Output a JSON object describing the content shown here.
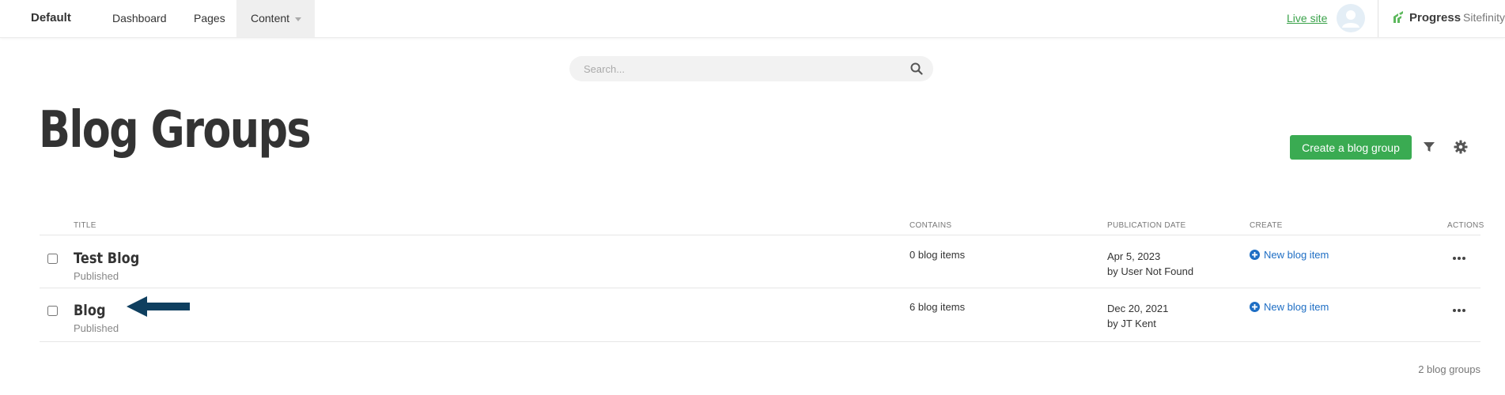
{
  "topbar": {
    "site_name": "Default",
    "nav": {
      "dashboard": "Dashboard",
      "pages": "Pages",
      "content": "Content"
    },
    "live_site": "Live site",
    "brand_progress": "Progress",
    "brand_sitefinity": "Sitefinity"
  },
  "search": {
    "placeholder": "Search..."
  },
  "page": {
    "title": "Blog Groups",
    "create_button": "Create a blog group"
  },
  "table": {
    "headers": {
      "title": "TITLE",
      "contains": "CONTAINS",
      "publication_date": "PUBLICATION DATE",
      "create": "CREATE",
      "actions": "ACTIONS"
    },
    "rows": [
      {
        "title": "Test Blog",
        "status": "Published",
        "contains": "0 blog items",
        "date": "Apr 5, 2023",
        "author": "by User Not Found",
        "create_label": "New blog item"
      },
      {
        "title": "Blog",
        "status": "Published",
        "contains": "6 blog items",
        "date": "Dec 20, 2021",
        "author": "by JT Kent",
        "create_label": "New blog item"
      }
    ]
  },
  "footer": {
    "count": "2 blog groups"
  },
  "colors": {
    "accent_green": "#3aab52",
    "link_green": "#3aa24a",
    "link_blue": "#1e6ec4",
    "arrow": "#0f3f5f"
  }
}
